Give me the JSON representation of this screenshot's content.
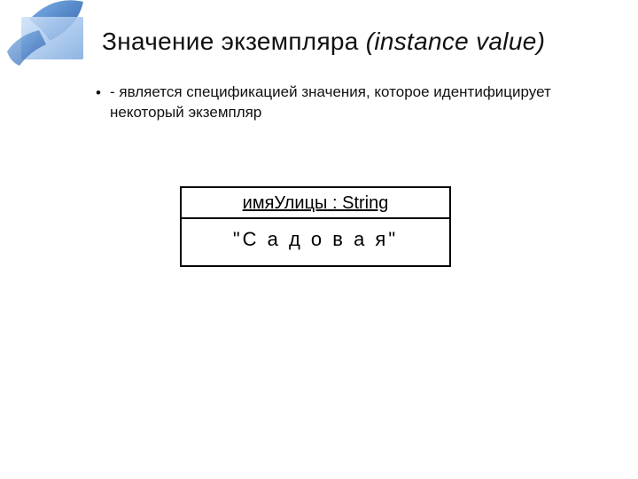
{
  "title": {
    "roman": "Значение экземпляра ",
    "italic": "(instance value)"
  },
  "bullets": [
    "- является спецификацией значения, которое идентифицирует некоторый экземпляр"
  ],
  "diagram": {
    "instance_name": "имяУлицы",
    "type_sep": " : ",
    "type_name": "String",
    "value": "\"С а д о в а я\""
  }
}
